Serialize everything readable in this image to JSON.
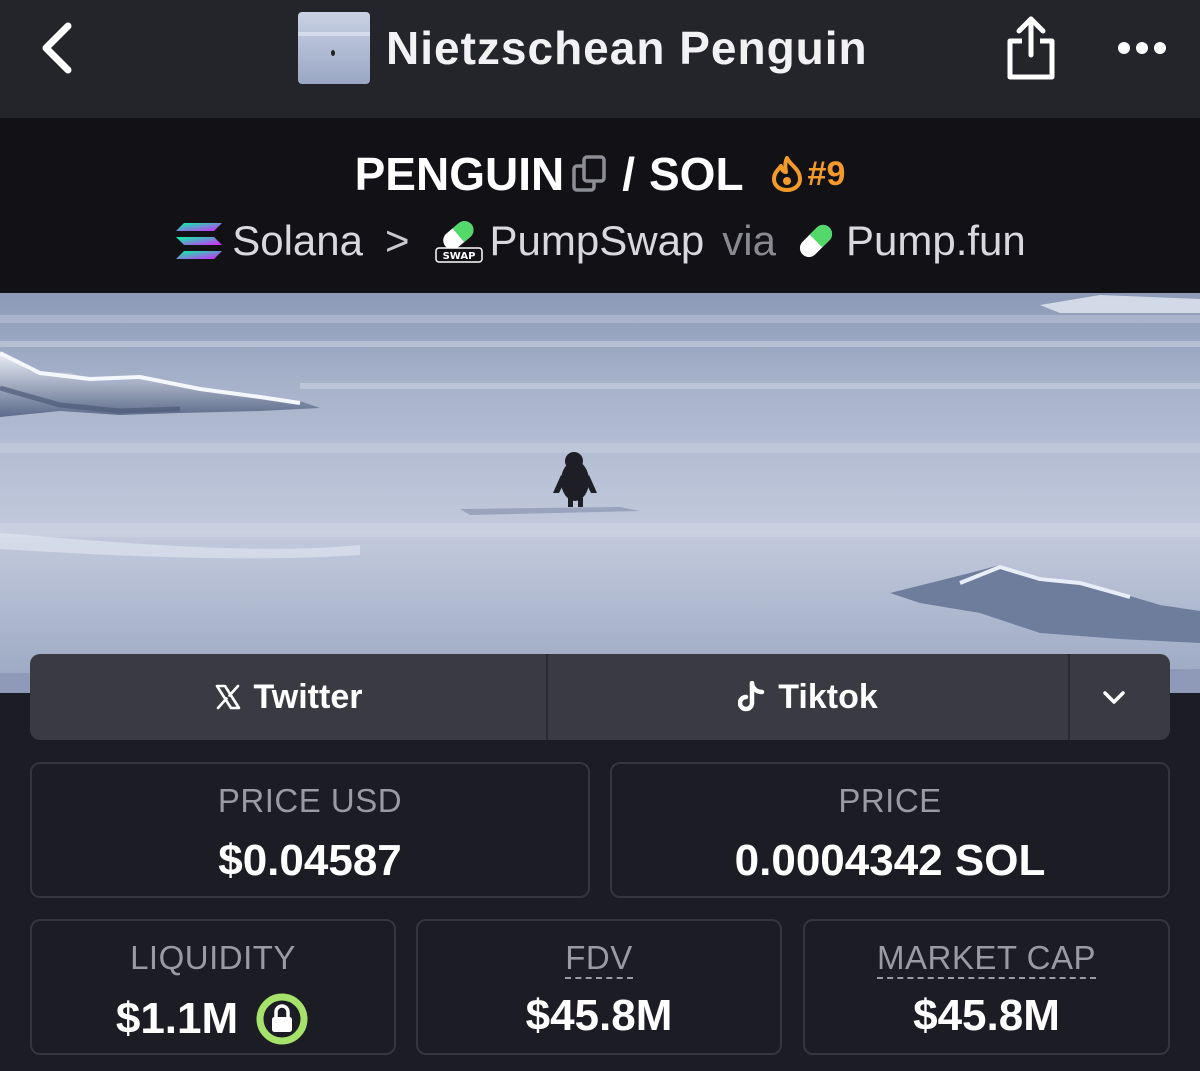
{
  "header": {
    "title": "Nietzschean Penguin",
    "back_icon": "chevron-left-icon",
    "share_icon": "share-icon",
    "more_icon": "more-horizontal-icon"
  },
  "pair": {
    "base": "PENGUIN",
    "slash": "/",
    "quote": "SOL",
    "rank": "#9",
    "rank_color": "#f49a2a"
  },
  "chain": {
    "network": "Solana",
    "separator": ">",
    "dex": "PumpSwap",
    "dex_badge": "SWAP",
    "via": "via",
    "launchpad": "Pump.fun"
  },
  "socials": {
    "twitter_label": "Twitter",
    "tiktok_label": "Tiktok"
  },
  "stats": {
    "price_usd_label": "PRICE USD",
    "price_usd_value": "$0.04587",
    "price_label": "PRICE",
    "price_value": "0.0004342 SOL",
    "liquidity_label": "LIQUIDITY",
    "liquidity_value": "$1.1M",
    "fdv_label": "FDV",
    "fdv_value": "$45.8M",
    "mcap_label": "MARKET CAP",
    "mcap_value": "$45.8M"
  },
  "colors": {
    "background": "#1c1c24",
    "topbar": "#24242b",
    "pair_header": "#111116",
    "accent_orange": "#f49a2a",
    "liquidity_lock_green": "#a6e26b"
  }
}
